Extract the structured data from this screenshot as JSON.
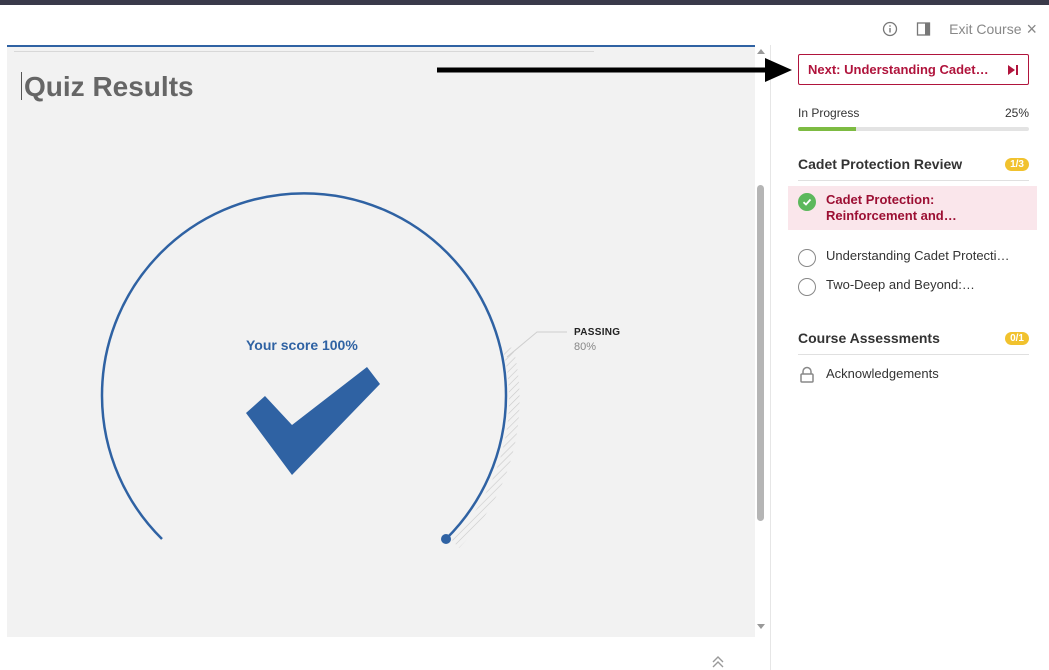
{
  "top_actions": {
    "exit_label": "Exit Course"
  },
  "content": {
    "title": "Quiz Results",
    "score_label": "Your score 100%",
    "score_percent": 100,
    "passing_label": "PASSING",
    "passing_value": "80%",
    "passing_percent": 80
  },
  "sidebar": {
    "next_button_label": "Next: Understanding Cadet…",
    "progress": {
      "status_label": "In Progress",
      "percent_label": "25%",
      "percent": 25
    },
    "sections": [
      {
        "title": "Cadet Protection Review",
        "badge": "1/3",
        "lessons": [
          {
            "label": "Cadet Protection: Reinforcement and…",
            "status": "complete",
            "active": true
          },
          {
            "label": "Understanding Cadet Protecti…",
            "status": "not-started",
            "active": false
          },
          {
            "label": "Two-Deep and Beyond:…",
            "status": "not-started",
            "active": false
          }
        ]
      },
      {
        "title": "Course Assessments",
        "badge": "0/1",
        "lessons": [
          {
            "label": "Acknowledgements",
            "status": "locked",
            "active": false
          }
        ]
      }
    ]
  },
  "colors": {
    "accent_blue": "#2f62a3",
    "brand_red": "#b0143c",
    "progress_green": "#7dbb42",
    "badge_yellow": "#f1c22e",
    "complete_green": "#5cb85c"
  }
}
